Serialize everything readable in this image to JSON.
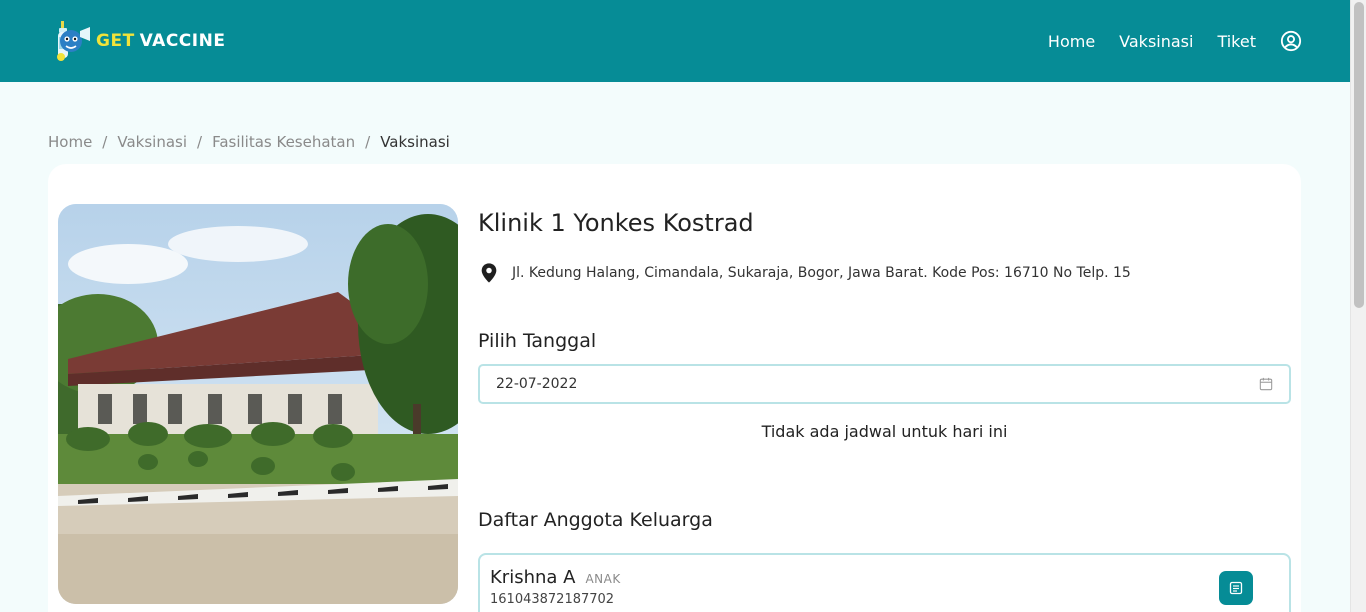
{
  "brand": {
    "get": "GET",
    "vaccine": "VACCINE"
  },
  "nav": {
    "home": "Home",
    "vaksinasi": "Vaksinasi",
    "tiket": "Tiket"
  },
  "breadcrumb": {
    "items": [
      "Home",
      "Vaksinasi",
      "Fasilitas Kesehatan",
      "Vaksinasi"
    ],
    "separator": "/"
  },
  "clinic": {
    "name": "Klinik 1 Yonkes Kostrad",
    "address": "Jl. Kedung Halang, Cimandala, Sukaraja, Bogor, Jawa Barat. Kode Pos: 16710 No Telp. 15"
  },
  "date_section": {
    "title": "Pilih Tanggal",
    "value": "22-07-2022",
    "empty_message": "Tidak ada jadwal untuk hari ini"
  },
  "family": {
    "title": "Daftar Anggota Keluarga",
    "members": [
      {
        "name": "Krishna A",
        "role": "ANAK",
        "nik": "161043872187702"
      }
    ]
  },
  "colors": {
    "primary": "#068c96",
    "accent": "#f1e33a",
    "background": "#f3fcfc",
    "border": "#b9e3e6"
  },
  "icons": {
    "user": "user-circle-icon",
    "location": "map-pin-icon",
    "calendar": "calendar-icon",
    "detail": "document-icon"
  }
}
